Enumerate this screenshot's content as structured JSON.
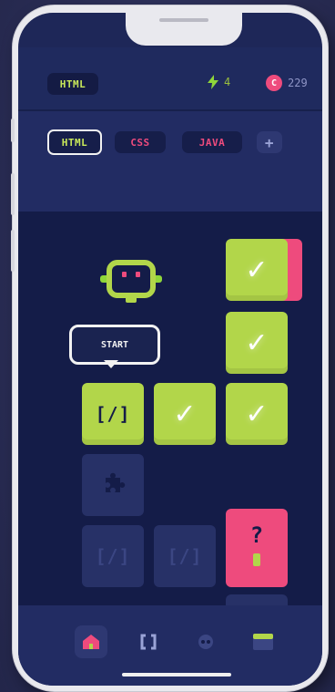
{
  "header": {
    "language_badge": "HTML",
    "energy_count": "4",
    "coin_symbol": "C",
    "coin_count": "229"
  },
  "tabs": [
    {
      "label": "HTML",
      "active": true
    },
    {
      "label": "CSS",
      "active": false
    },
    {
      "label": "JAVA",
      "active": false
    },
    {
      "label": "+",
      "active": false
    }
  ],
  "map": {
    "start_tooltip": "START",
    "start_tile_glyph": "[/]",
    "locked_tile_glyph": "[/]",
    "mystery_tile_glyph": "?",
    "checkmark": "✓"
  },
  "bottom_nav": [
    {
      "name": "home-icon",
      "active": true
    },
    {
      "name": "code-icon",
      "active": false
    },
    {
      "name": "robot-icon",
      "active": false
    },
    {
      "name": "window-icon",
      "active": false
    }
  ],
  "colors": {
    "accent_green": "#b2d64a",
    "accent_pink": "#ee4b7d",
    "background_navy": "#141c48",
    "panel_navy": "#222c63"
  }
}
